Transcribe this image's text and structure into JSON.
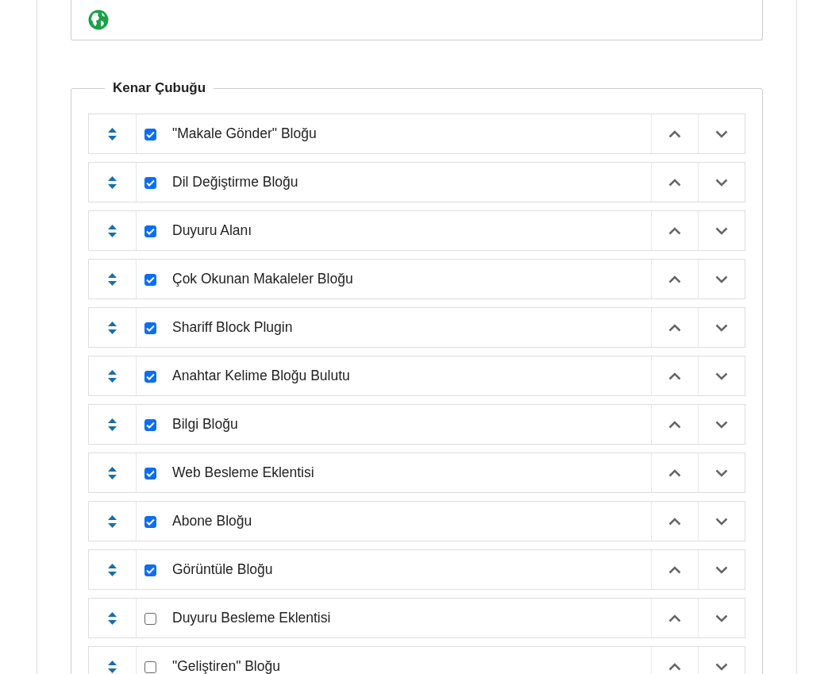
{
  "sidebar": {
    "legend": "Kenar Çubuğu",
    "blocks": [
      {
        "label": "\"Makale Gönder\" Bloğu",
        "checked": true
      },
      {
        "label": "Dil Değiştirme Bloğu",
        "checked": true
      },
      {
        "label": "Duyuru Alanı",
        "checked": true
      },
      {
        "label": "Çok Okunan Makaleler Bloğu",
        "checked": true
      },
      {
        "label": "Shariff Block Plugin",
        "checked": true
      },
      {
        "label": "Anahtar Kelime Bloğu Bulutu",
        "checked": true
      },
      {
        "label": "Bilgi Bloğu",
        "checked": true
      },
      {
        "label": "Web Besleme Eklentisi",
        "checked": true
      },
      {
        "label": "Abone Bloğu",
        "checked": true
      },
      {
        "label": "Görüntüle Bloğu",
        "checked": true
      },
      {
        "label": "Duyuru Besleme Eklentisi",
        "checked": false
      },
      {
        "label": "\"Geliştiren\" Bloğu",
        "checked": false
      }
    ]
  }
}
